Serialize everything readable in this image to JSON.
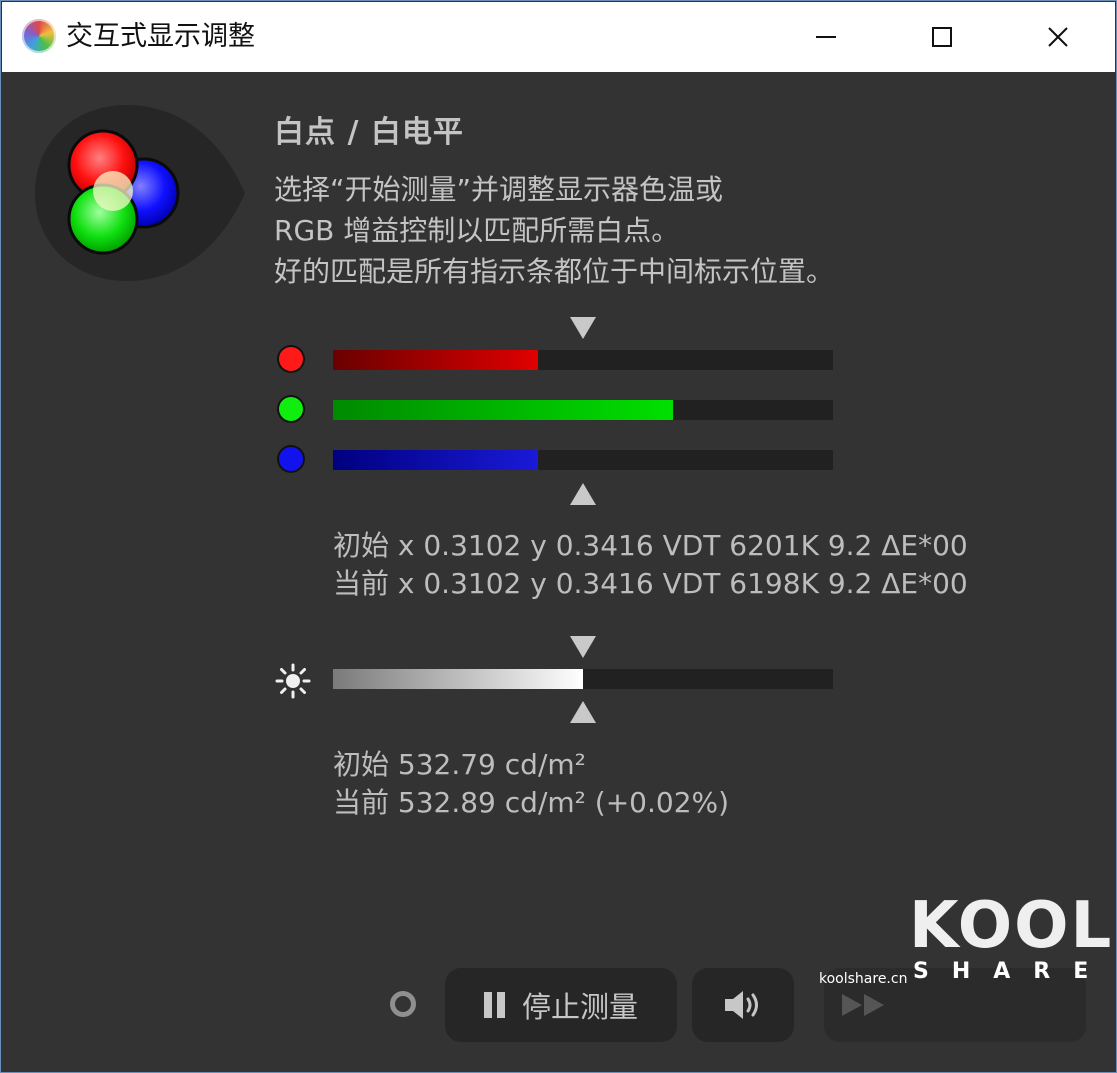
{
  "window": {
    "title": "交互式显示调整"
  },
  "header": {
    "heading": "白点 / 白电平",
    "description": [
      "选择“开始测量”并调整显示器色温或",
      "RGB 增益控制以匹配所需白点。",
      "好的匹配是所有指示条都位于中间标示位置。"
    ]
  },
  "rgb_bars": {
    "target_fraction": 0.5,
    "channels": [
      {
        "name": "red",
        "level": 0.41,
        "color": "#e00000",
        "dark": "#6a0000"
      },
      {
        "name": "green",
        "level": 0.68,
        "color": "#00e000",
        "dark": "#008a00"
      },
      {
        "name": "blue",
        "level": 0.41,
        "color": "#1a1ad8",
        "dark": "#000080"
      }
    ]
  },
  "whitepoint_readout": {
    "initial": "初始 x 0.3102 y 0.3416 VDT 6201K 9.2 ΔE*00",
    "current": "当前 x 0.3102 y 0.3416 VDT 6198K 9.2 ΔE*00"
  },
  "luminance_bar": {
    "level": 0.5,
    "target_fraction": 0.5
  },
  "luminance_readout": {
    "initial": "初始 532.79 cd/m²",
    "current": "当前 532.89 cd/m² (+0.02%)"
  },
  "buttons": {
    "stop_label": "停止测量",
    "sound_icon": "speaker-icon",
    "next_icon": "fast-forward-icon"
  },
  "watermark": {
    "logo_main": "KOOL",
    "logo_sub": "SHARE",
    "url": "koolshare.cn"
  }
}
